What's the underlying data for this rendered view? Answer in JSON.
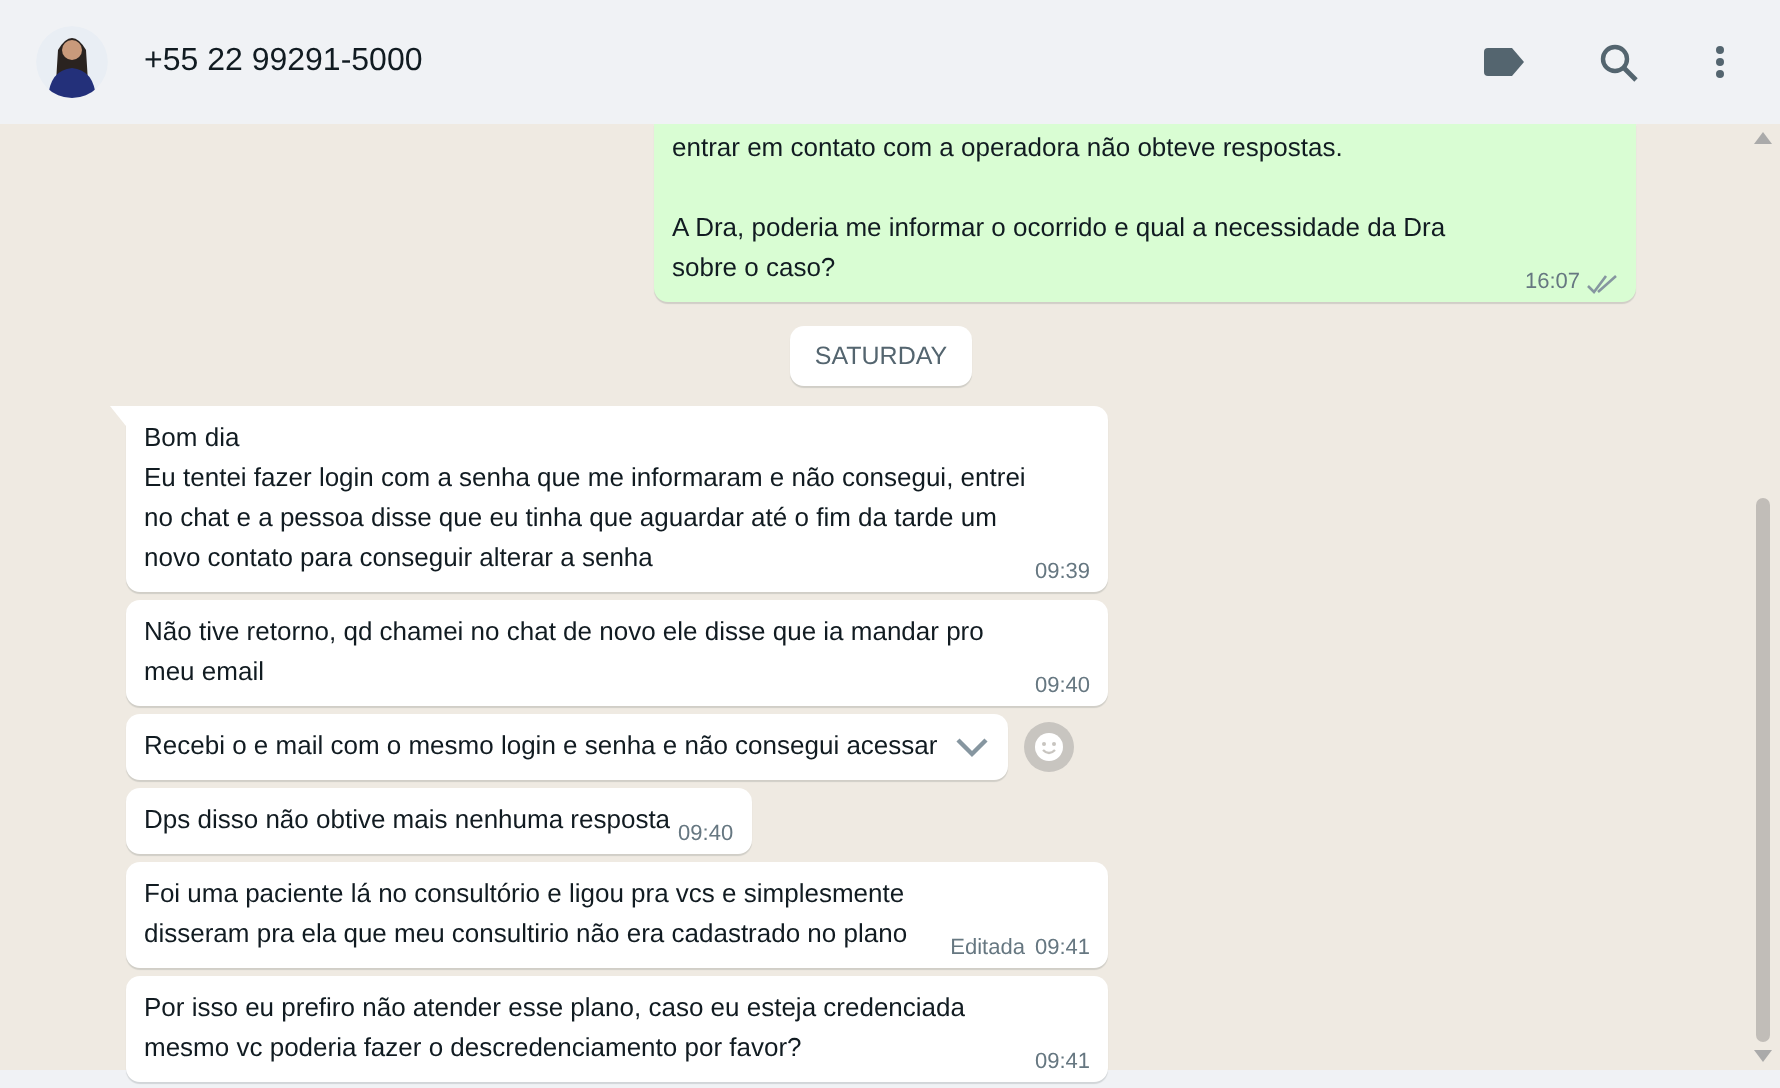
{
  "header": {
    "contact": "+55 22 99291-5000"
  },
  "messages": [
    {
      "kind": "sent",
      "text": "entrar em contato com a operadora não obteve respostas.\n\nA Dra, poderia me informar o ocorrido e qual a necessidade da Dra sobre o caso?",
      "time": "16:07",
      "read": false,
      "tail": false,
      "hovered": false
    },
    {
      "kind": "date",
      "text": "SATURDAY"
    },
    {
      "kind": "received",
      "text": "Bom dia\nEu tentei fazer login com a senha que me informaram e  não consegui, entrei no chat e  a pessoa disse que eu tinha que aguardar até o fim da tarde um novo contato para conseguir alterar a senha",
      "time": "09:39",
      "tail": true,
      "hovered": false
    },
    {
      "kind": "received",
      "text": "Não tive retorno, qd chamei no chat de novo ele disse que ia mandar pro meu email",
      "time": "09:40",
      "tail": false,
      "hovered": false
    },
    {
      "kind": "received",
      "text": "Recebi o e mail com o mesmo login e senha e não consegui acessar",
      "tail": false,
      "hovered": true
    },
    {
      "kind": "received",
      "text": "Dps disso não obtive mais nenhuma resposta",
      "time": "09:40",
      "tail": false,
      "hovered": false
    },
    {
      "kind": "received",
      "text": "Foi uma paciente lá no consultório e ligou pra vcs e simplesmente disseram pra ela que meu consultirio não  era cadastrado no plano",
      "edited_label": "Editada",
      "time": "09:41",
      "tail": false,
      "hovered": false
    },
    {
      "kind": "received",
      "text": "Por isso eu prefiro não atender esse plano, caso  eu esteja credenciada mesmo vc poderia fazer o descredenciamento por favor?",
      "time": "09:41",
      "tail": false,
      "hovered": false
    }
  ]
}
